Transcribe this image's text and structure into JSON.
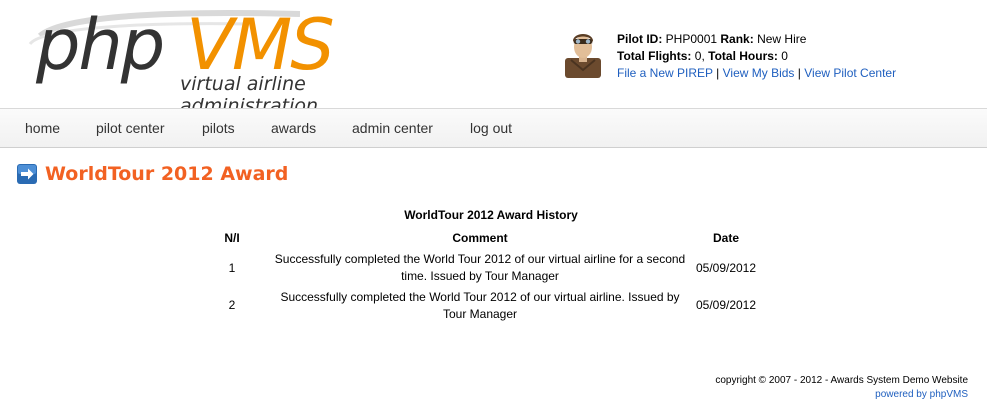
{
  "header": {
    "logo": {
      "php": "php",
      "vms": "VMS",
      "subtitle": "virtual airline administration"
    },
    "pilot": {
      "id_label": "Pilot ID:",
      "id_value": "PHP0001",
      "rank_label": "Rank:",
      "rank_value": "New Hire",
      "flights_label": "Total Flights:",
      "flights_value": "0,",
      "hours_label": "Total Hours:",
      "hours_value": "0",
      "links": [
        "File a New PIREP",
        "View My Bids",
        "View Pilot Center"
      ],
      "separator": "|"
    }
  },
  "nav": {
    "items": [
      "home",
      "pilot center",
      "pilots",
      "awards",
      "admin center",
      "log out"
    ]
  },
  "page": {
    "title": "WorldTour 2012 Award"
  },
  "table": {
    "caption": "WorldTour 2012 Award History",
    "columns": [
      "N/I",
      "Comment",
      "Date"
    ],
    "rows": [
      {
        "n": "1",
        "comment_line1": "Successfully completed the World Tour 2012 of our virtual airline for a second",
        "comment_line2": "time. Issued by Tour Manager",
        "date": "05/09/2012"
      },
      {
        "n": "2",
        "comment_line1": "Successfully completed the World Tour 2012 of our virtual airline. Issued by",
        "comment_line2": "Tour Manager",
        "date": "05/09/2012"
      }
    ]
  },
  "footer": {
    "copyright": "copyright © 2007 - 2012 - Awards System Demo Website",
    "powered": "powered by phpVMS"
  },
  "colors": {
    "accent_orange": "#f26122",
    "logo_orange": "#f29100",
    "link_blue": "#1f5fbf",
    "arrow_blue": "#2a6bb3"
  }
}
